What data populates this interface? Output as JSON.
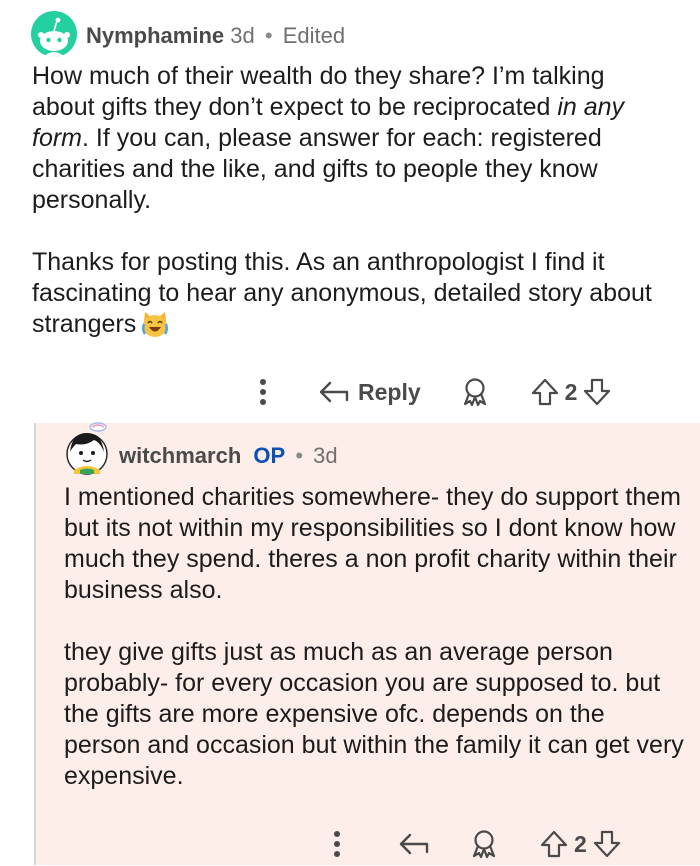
{
  "top_comment": {
    "username": "Nymphamine",
    "age": "3d",
    "edited": "Edited",
    "paragraphs": [
      "How much of their wealth do they share? I’m talking about gifts they don’t expect to be reciprocated ",
      "in any form",
      ". If you can, please answer for each: registered charities and the like, and gifts to people they know personally.",
      "Thanks for posting this. As an anthropologist I find it fascinating to hear any anonymous, detailed story about strangers"
    ],
    "emoji": "cat-joy-emoji",
    "reply_label": "Reply",
    "vote_count": "2"
  },
  "reply_comment": {
    "username": "witchmarch",
    "op_badge": "OP",
    "age": "3d",
    "paragraphs": [
      "I mentioned charities somewhere- they do support them but its not within my responsibilities so I dont know how much they spend. theres a non profit charity within their business also.",
      "they give gifts just as much as an average person probably- for every occasion you are supposed to. but the gifts are more expensive ofc. depends on the person and occasion but within the family it can get very expensive."
    ],
    "vote_count": "2"
  },
  "colors": {
    "avatar_bg": "#24d0a0",
    "reply_bg": "#fdeeea",
    "op_color": "#0e4fb3"
  },
  "icons": [
    "more-vertical-icon",
    "reply-arrow-icon",
    "award-icon",
    "upvote-icon",
    "downvote-icon"
  ]
}
